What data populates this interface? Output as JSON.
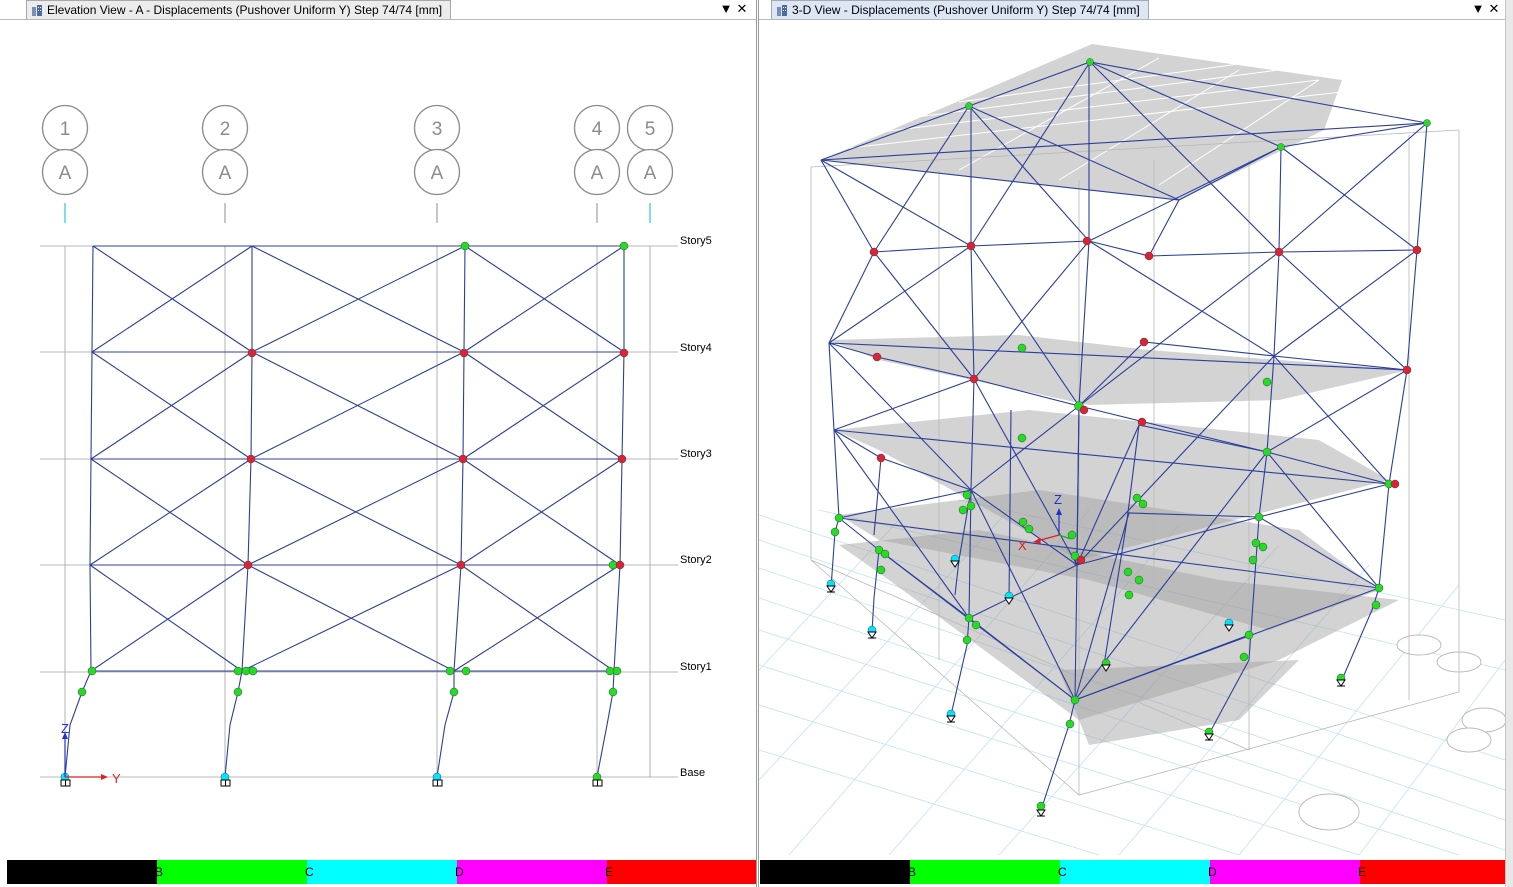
{
  "left_view": {
    "title": "Elevation View - A   - Displacements (Pushover Uniform Y)  Step 74/74  [mm]",
    "grid_bubbles": [
      {
        "number": "1",
        "letter": "A"
      },
      {
        "number": "2",
        "letter": "A"
      },
      {
        "number": "3",
        "letter": "A"
      },
      {
        "number": "4",
        "letter": "A"
      },
      {
        "number": "5",
        "letter": "A"
      }
    ],
    "stories": [
      "Story5",
      "Story4",
      "Story3",
      "Story2",
      "Story1",
      "Base"
    ],
    "axis": {
      "vertical": "Z",
      "horizontal": "Y"
    }
  },
  "right_view": {
    "title": "3-D View   - Displacements (Pushover Uniform Y)  Step 74/74  [mm]",
    "axis": {
      "vertical": "Z",
      "horizontal": "X"
    }
  },
  "window_controls": {
    "dropdown": "▼",
    "close": "✕"
  },
  "hinge_legend": [
    {
      "label": "",
      "color": "#000000"
    },
    {
      "label": "B",
      "color": "#00ff00"
    },
    {
      "label": "C",
      "color": "#00ffff"
    },
    {
      "label": "D",
      "color": "#ff00ff"
    },
    {
      "label": "E",
      "color": "#ff0000"
    }
  ],
  "colors": {
    "frame": "#2c3f9b",
    "hinge_b": "#22dd22",
    "hinge_e": "#dd2233",
    "hinge_base": "#00e5ff",
    "grid_gray": "#9a9a9a"
  }
}
